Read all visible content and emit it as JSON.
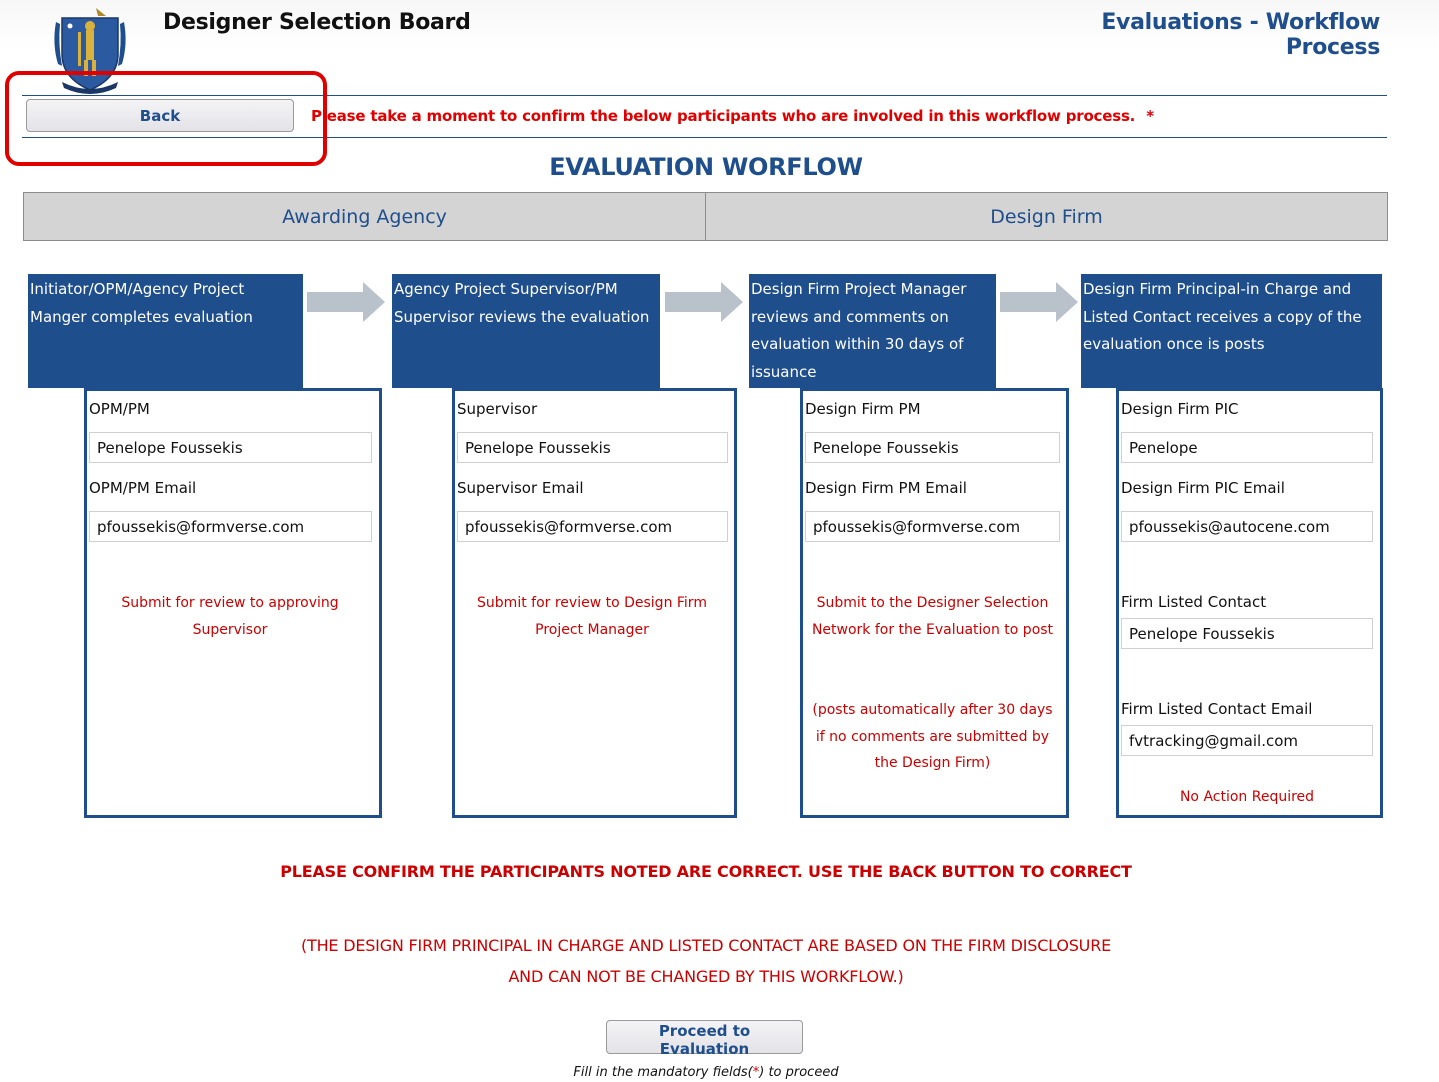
{
  "header": {
    "title": "Designer Selection Board",
    "section": "Evaluations - Workflow Process",
    "seal_icon": "massachusetts-seal-icon"
  },
  "toolbar": {
    "back_label": "Back",
    "confirm_message": "Please take a moment to confirm the below participants who are involved in this workflow process.",
    "required_marker": "*"
  },
  "workflow": {
    "title": "EVALUATION WORFLOW",
    "lanes": [
      "Awarding Agency",
      "Design Firm"
    ],
    "steps": [
      {
        "description": "Initiator/OPM/Agency Project Manger completes evaluation",
        "name_label": "OPM/PM",
        "name_value": "Penelope Foussekis",
        "email_label": "OPM/PM Email",
        "email_value": "pfoussekis@formverse.com",
        "note": "Submit for review to approving Supervisor"
      },
      {
        "description": "Agency Project Supervisor/PM Supervisor reviews the evaluation",
        "name_label": "Supervisor",
        "name_value": "Penelope Foussekis",
        "email_label": "Supervisor Email",
        "email_value": "pfoussekis@formverse.com",
        "note": "Submit for review to Design Firm Project Manager"
      },
      {
        "description": "Design Firm Project Manager reviews and comments on evaluation within 30 days of issuance",
        "name_label": "Design Firm PM",
        "name_value": "Penelope Foussekis",
        "email_label": "Design Firm PM Email",
        "email_value": "pfoussekis@formverse.com",
        "note": "Submit to the Designer Selection Network for the Evaluation to post",
        "note2": "(posts automatically after 30 days if no comments are submitted by the Design Firm)"
      },
      {
        "description": "Design Firm Principal-in Charge and Listed Contact receives a copy of the evaluation once is posts",
        "name_label": "Design Firm PIC",
        "name_value": "Penelope",
        "email_label": "Design Firm PIC Email",
        "email_value": "pfoussekis@autocene.com",
        "contact_label": "Firm Listed Contact",
        "contact_value": "Penelope Foussekis",
        "contact_email_label": "Firm Listed Contact Email",
        "contact_email_value": "fvtracking@gmail.com",
        "note": "No Action Required"
      }
    ]
  },
  "footer": {
    "confirm": "PLEASE CONFIRM THE PARTICIPANTS NOTED ARE CORRECT. USE THE BACK BUTTON TO CORRECT",
    "disclosure_line1": "(THE DESIGN FIRM PRINCIPAL IN CHARGE AND LISTED CONTACT ARE BASED ON THE FIRM DISCLOSURE",
    "disclosure_line2": "AND CAN NOT BE CHANGED BY THIS WORKFLOW.)",
    "proceed_label": "Proceed to Evaluation",
    "fill_note_pre": "Fill in the mandatory fields(",
    "fill_note_star": "*",
    "fill_note_post": ") to proceed"
  },
  "colors": {
    "brand_blue": "#1f4e8c",
    "alert_red": "#cc0000",
    "highlight_red": "#e00000",
    "lane_gray": "#d4d4d4"
  }
}
